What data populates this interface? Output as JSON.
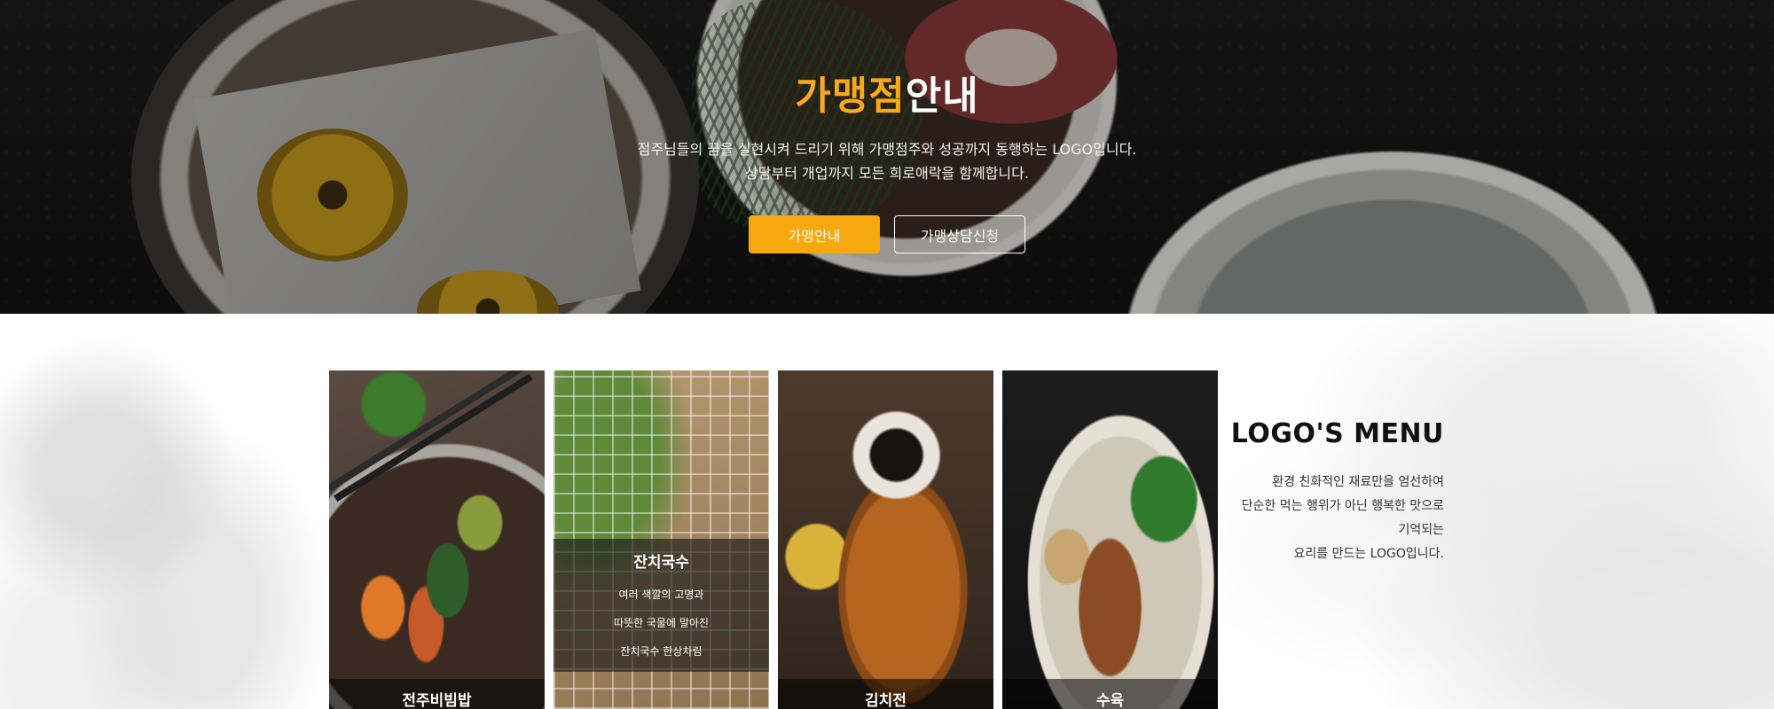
{
  "hero": {
    "title_accent": "가맹점",
    "title_rest": "안내",
    "desc_line1": "점주님들의 꿈을 실현시켜 드리기 위해 가맹점주와 성공까지 동행하는 LOGO입니다.",
    "desc_line2": "상담부터 개업까지 모든 희로애락을 함께합니다.",
    "btn_primary": "가맹안내",
    "btn_secondary": "가맹상담신청",
    "accent_color": "#f7a80f"
  },
  "menu": {
    "cards": [
      {
        "name": "전주비빔밥"
      },
      {
        "name": "잔치국수",
        "overlay_lines": [
          "여러 색깔의 고명과",
          "따뜻한 국물에 말아진",
          "잔치국수 한상차림"
        ]
      },
      {
        "name": "김치전"
      },
      {
        "name": "수육"
      }
    ],
    "title": "LOGO'S MENU",
    "desc_lines": [
      "환경 친화적인 재료만을 엄선하여",
      "단순한 먹는 행위가 아닌 행복한 맛으로",
      "기억되는",
      "요리를 만드는 LOGO입니다."
    ]
  }
}
